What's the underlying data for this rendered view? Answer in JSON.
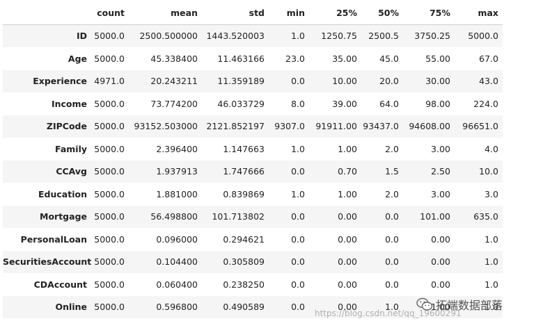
{
  "table": {
    "columns": [
      "",
      "count",
      "mean",
      "std",
      "min",
      "25%",
      "50%",
      "75%",
      "max"
    ],
    "rows": [
      {
        "label": "ID",
        "values": [
          "5000.0",
          "2500.500000",
          "1443.520003",
          "1.0",
          "1250.75",
          "2500.5",
          "3750.25",
          "5000.0"
        ]
      },
      {
        "label": "Age",
        "values": [
          "5000.0",
          "45.338400",
          "11.463166",
          "23.0",
          "35.00",
          "45.0",
          "55.00",
          "67.0"
        ]
      },
      {
        "label": "Experience",
        "values": [
          "4971.0",
          "20.243211",
          "11.359189",
          "0.0",
          "10.00",
          "20.0",
          "30.00",
          "43.0"
        ]
      },
      {
        "label": "Income",
        "values": [
          "5000.0",
          "73.774200",
          "46.033729",
          "8.0",
          "39.00",
          "64.0",
          "98.00",
          "224.0"
        ]
      },
      {
        "label": "ZIPCode",
        "values": [
          "5000.0",
          "93152.503000",
          "2121.852197",
          "9307.0",
          "91911.00",
          "93437.0",
          "94608.00",
          "96651.0"
        ]
      },
      {
        "label": "Family",
        "values": [
          "5000.0",
          "2.396400",
          "1.147663",
          "1.0",
          "1.00",
          "2.0",
          "3.00",
          "4.0"
        ]
      },
      {
        "label": "CCAvg",
        "values": [
          "5000.0",
          "1.937913",
          "1.747666",
          "0.0",
          "0.70",
          "1.5",
          "2.50",
          "10.0"
        ]
      },
      {
        "label": "Education",
        "values": [
          "5000.0",
          "1.881000",
          "0.839869",
          "1.0",
          "1.00",
          "2.0",
          "3.00",
          "3.0"
        ]
      },
      {
        "label": "Mortgage",
        "values": [
          "5000.0",
          "56.498800",
          "101.713802",
          "0.0",
          "0.00",
          "0.0",
          "101.00",
          "635.0"
        ]
      },
      {
        "label": "PersonalLoan",
        "values": [
          "5000.0",
          "0.096000",
          "0.294621",
          "0.0",
          "0.00",
          "0.0",
          "0.00",
          "1.0"
        ]
      },
      {
        "label": "SecuritiesAccount",
        "values": [
          "5000.0",
          "0.104400",
          "0.305809",
          "0.0",
          "0.00",
          "0.0",
          "0.00",
          "1.0"
        ]
      },
      {
        "label": "CDAccount",
        "values": [
          "5000.0",
          "0.060400",
          "0.238250",
          "0.0",
          "0.00",
          "0.0",
          "0.00",
          "1.0"
        ]
      },
      {
        "label": "Online",
        "values": [
          "5000.0",
          "0.596800",
          "0.490589",
          "0.0",
          "0.00",
          "1.0",
          "1.00",
          "1.0"
        ]
      }
    ]
  },
  "watermark": {
    "text": "拓端数据部落",
    "url": "https://blog.csdn.net/qq_19600291",
    "icon": "wechat-icon"
  }
}
